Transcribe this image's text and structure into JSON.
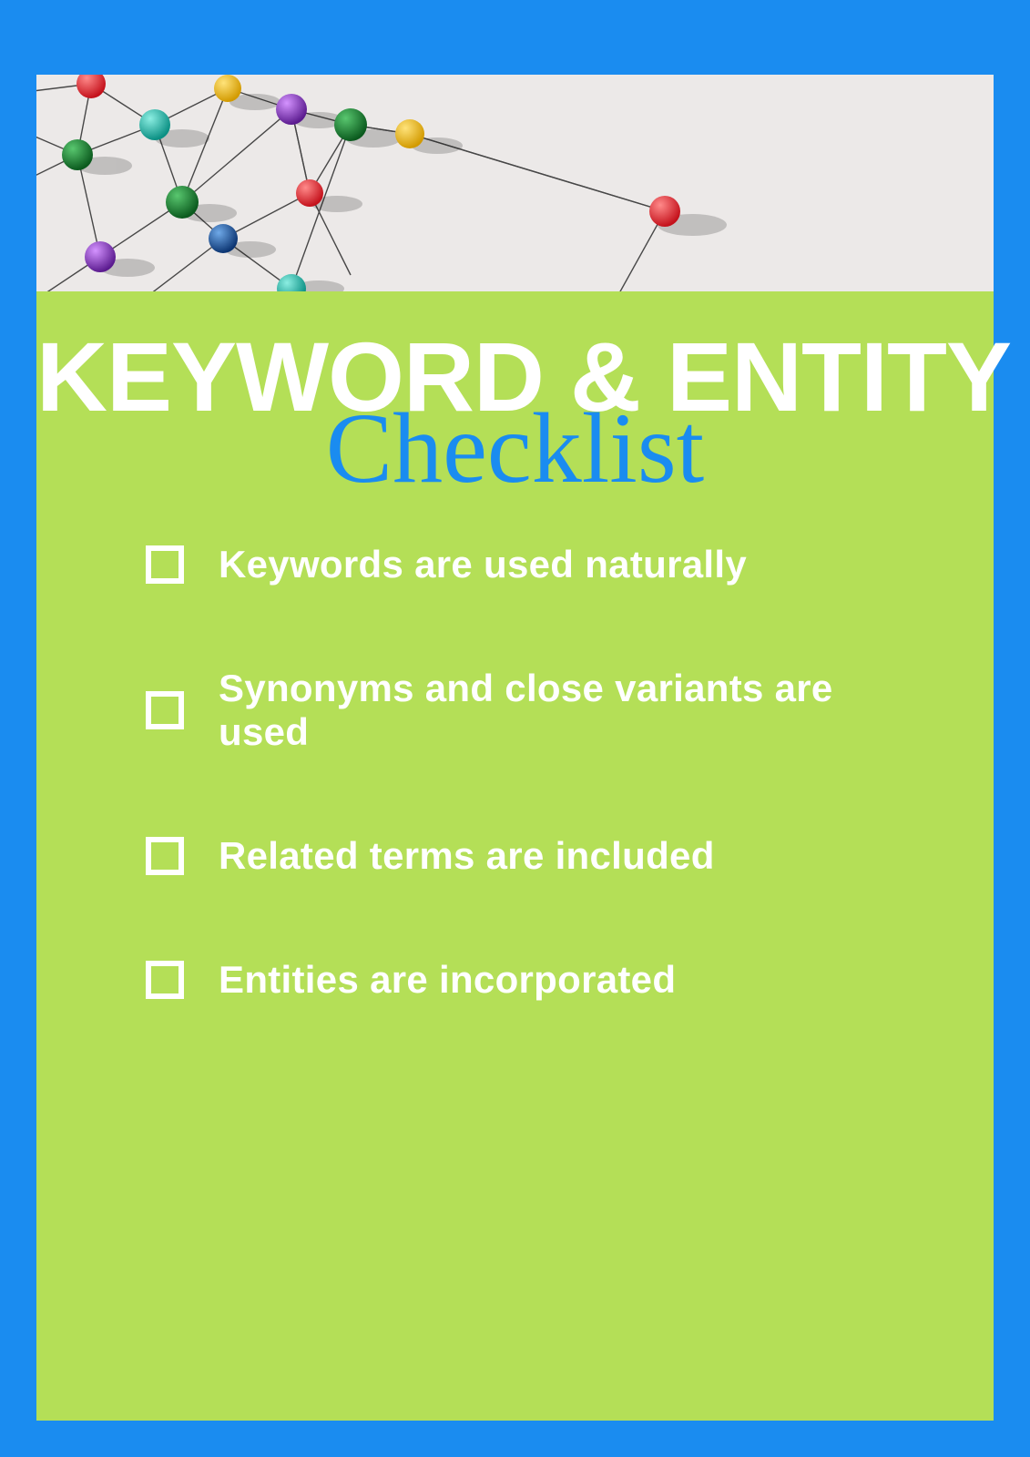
{
  "title": {
    "main": "KEYWORD & ENTITY",
    "script": "Checklist"
  },
  "checklist": {
    "items": [
      {
        "label": "Keywords are used naturally"
      },
      {
        "label": "Synonyms and close variants are used"
      },
      {
        "label": "Related terms are included"
      },
      {
        "label": "Entities are incorporated"
      }
    ]
  },
  "colors": {
    "frame": "#1a8cf0",
    "card": "#b4df57",
    "text": "#ffffff"
  }
}
